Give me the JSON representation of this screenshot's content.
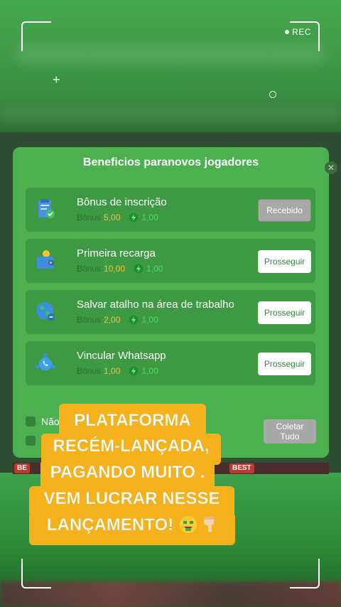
{
  "recorder": {
    "rec_label": "REC"
  },
  "modal": {
    "title": "Beneficios paranovos jogadores",
    "close_icon": "close-icon",
    "items": [
      {
        "icon": "clipboard-check-icon",
        "title": "Bônus de inscrição",
        "bonus_label": "Bônus",
        "bonus_value": "5,00",
        "energy_value": "1,00",
        "action_label": "Recebido",
        "action_state": "received"
      },
      {
        "icon": "wallet-coin-icon",
        "title": "Primeira recarga",
        "bonus_label": "Bônus",
        "bonus_value": "10,00",
        "energy_value": "1,00",
        "action_label": "Prosseguir",
        "action_state": "continue"
      },
      {
        "icon": "globe-link-icon",
        "title": "Salvar atalho na área de trabalho",
        "bonus_label": "Bônus",
        "bonus_value": "2,00",
        "energy_value": "1,00",
        "action_label": "Prosseguir",
        "action_state": "continue"
      },
      {
        "icon": "whatsapp-icon",
        "title": "Vincular Whatsapp",
        "bonus_label": "Bônus",
        "bonus_value": "1,00",
        "energy_value": "1,00",
        "action_label": "Prosseguir",
        "action_state": "continue"
      }
    ],
    "checkbox_label": "Não",
    "collect_line1": "Coletar",
    "collect_line2": "Tudo"
  },
  "promo_strip": {
    "left_tag": "BE",
    "right_tag": "BEST"
  },
  "caption": {
    "line1": "PLATAFORMA",
    "line2": "RECÉM-LANÇADA,",
    "line3": "PAGANDO MUITO .",
    "line4": "VEM LUCRAR NESSE",
    "line5": "LANÇAMENTO!",
    "emoji1": "money-face-emoji",
    "emoji2": "pointing-down-emoji"
  },
  "colors": {
    "modal_bg": "#4cb051",
    "card_bg": "#3d9a43",
    "bonus_value": "#f3c23a",
    "energy_value": "#45e05a",
    "caption_bg": "#f5b21c"
  }
}
